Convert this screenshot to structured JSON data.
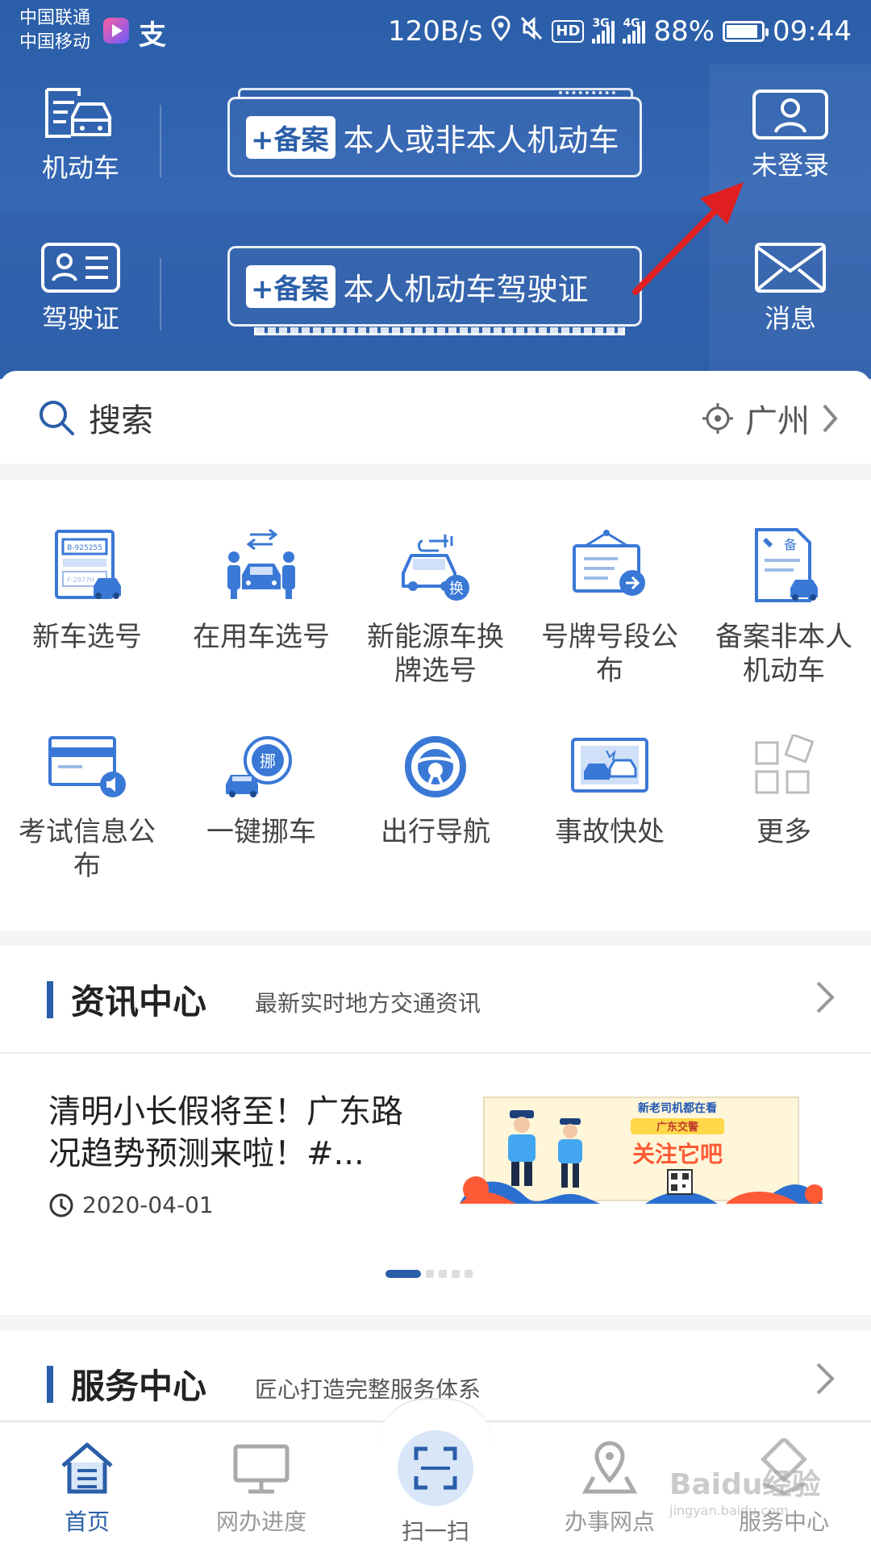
{
  "status_bar": {
    "carrier1": "中国联通",
    "carrier2": "中国移动",
    "speed": "120B/s",
    "hd": "HD",
    "gen1": "3G",
    "gen2": "4G",
    "battery": "88%",
    "time": "09:44"
  },
  "header": {
    "vehicle_label": "机动车",
    "license_label": "驾驶证",
    "login_label": "未登录",
    "message_label": "消息",
    "banner1": {
      "tag": "+备案",
      "text": "本人或非本人机动车"
    },
    "banner2": {
      "tag": "+备案",
      "text": "本人机动车驾驶证"
    }
  },
  "search": {
    "placeholder": "搜索",
    "city": "广州"
  },
  "services_grid": [
    {
      "label": "新车选号",
      "icon": "new-plate-icon"
    },
    {
      "label": "在用车选号",
      "icon": "used-car-plate-icon"
    },
    {
      "label": "新能源车换牌选号",
      "icon": "ev-plate-icon"
    },
    {
      "label": "号牌号段公布",
      "icon": "plate-notice-icon"
    },
    {
      "label": "备案非本人机动车",
      "icon": "record-vehicle-icon"
    },
    {
      "label": "考试信息公布",
      "icon": "exam-info-icon"
    },
    {
      "label": "一键挪车",
      "icon": "move-car-icon"
    },
    {
      "label": "出行导航",
      "icon": "steering-wheel-icon"
    },
    {
      "label": "事故快处",
      "icon": "accident-icon"
    },
    {
      "label": "更多",
      "icon": "more-icon"
    }
  ],
  "grid_icon_texts": {
    "plate_top": "B-925255",
    "plate_bottom": "F-2977H",
    "swap": "换",
    "move": "挪",
    "record": "备"
  },
  "news": {
    "title": "资讯中心",
    "subtitle": "最新实时地方交通资讯",
    "headline": "清明小长假将至！广东路况趋势预测来啦！#...",
    "date": "2020-04-01",
    "image_line1": "新老司机都在看",
    "image_line2": "广东交警",
    "image_line3": "关注它吧"
  },
  "service_center": {
    "title": "服务中心",
    "subtitle": "匠心打造完整服务体系"
  },
  "bottom_nav": [
    {
      "label": "首页",
      "active": true
    },
    {
      "label": "网办进度",
      "active": false
    },
    {
      "label": "扫一扫",
      "active": false
    },
    {
      "label": "办事网点",
      "active": false
    },
    {
      "label": "服务中心",
      "active": false
    }
  ],
  "watermark": {
    "text": "Baidu经验",
    "url": "jingyan.baidu.com"
  },
  "colors": {
    "brand_blue": "#2a5ea8",
    "icon_blue": "#3a78d6",
    "annotation_red": "#e02020"
  }
}
